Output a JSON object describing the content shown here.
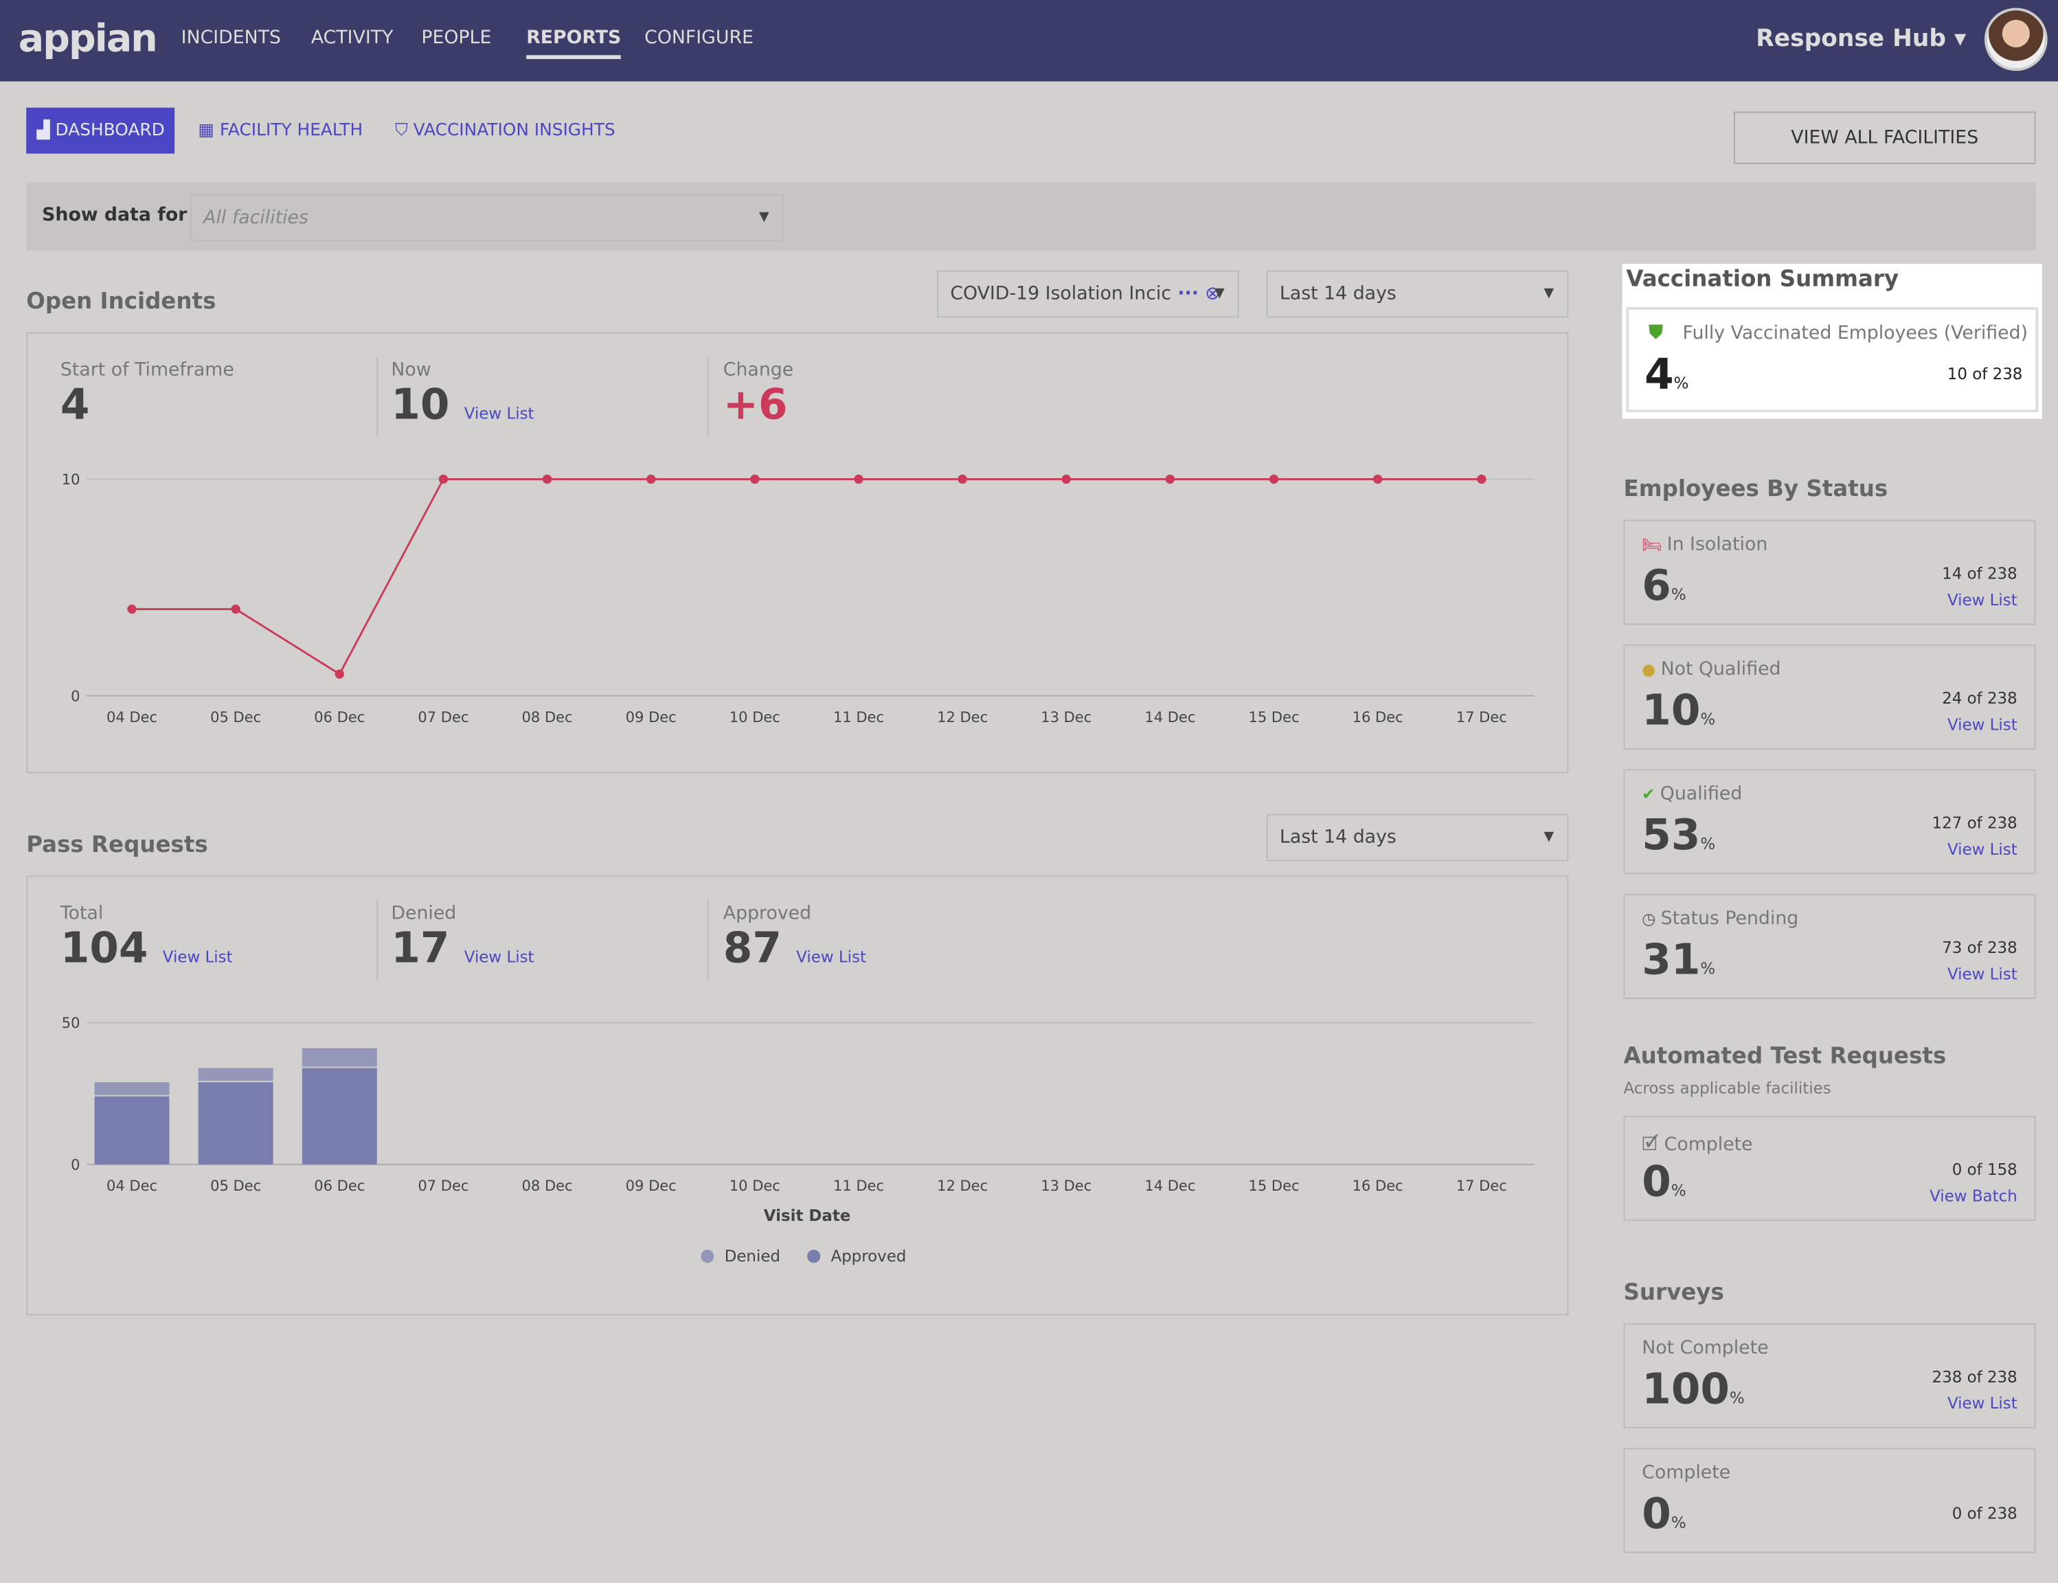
{
  "header": {
    "logo": "appian",
    "nav": [
      "INCIDENTS",
      "ACTIVITY",
      "PEOPLE",
      "REPORTS",
      "CONFIGURE"
    ],
    "active": "REPORTS",
    "site": "Response Hub ▾"
  },
  "subtabs": [
    {
      "label": "DASHBOARD",
      "icon": "bar-chart-icon"
    },
    {
      "label": "FACILITY HEALTH",
      "icon": "building-icon"
    },
    {
      "label": "VACCINATION INSIGHTS",
      "icon": "shield-icon"
    }
  ],
  "view_all": "VIEW ALL FACILITIES",
  "filter": {
    "label": "Show data for",
    "placeholder": "All facilities"
  },
  "open_incidents": {
    "title": "Open Incidents",
    "type_filter": "COVID-19 Isolation Incic",
    "range": "Last 14 days",
    "kpis": [
      {
        "label": "Start of Timeframe",
        "value": "4"
      },
      {
        "label": "Now",
        "value": "10",
        "link": "View List"
      },
      {
        "label": "Change",
        "value": "+6"
      }
    ]
  },
  "pass_requests": {
    "title": "Pass Requests",
    "range": "Last 14 days",
    "kpis": [
      {
        "label": "Total",
        "value": "104",
        "link": "View List"
      },
      {
        "label": "Denied",
        "value": "17",
        "link": "View List"
      },
      {
        "label": "Approved",
        "value": "87",
        "link": "View List"
      }
    ]
  },
  "chart_data": [
    {
      "type": "line",
      "categories": [
        "04 Dec",
        "05 Dec",
        "06 Dec",
        "07 Dec",
        "08 Dec",
        "09 Dec",
        "10 Dec",
        "11 Dec",
        "12 Dec",
        "13 Dec",
        "14 Dec",
        "15 Dec",
        "16 Dec",
        "17 Dec"
      ],
      "values": [
        4,
        4,
        1,
        10,
        10,
        10,
        10,
        10,
        10,
        10,
        10,
        10,
        10,
        10
      ],
      "ylim": [
        0,
        10
      ],
      "yticks": [
        "0",
        "10"
      ],
      "color": "#cc3a5a",
      "grid": true
    },
    {
      "type": "bar",
      "stacked": true,
      "categories": [
        "04 Dec",
        "05 Dec",
        "06 Dec",
        "07 Dec",
        "08 Dec",
        "09 Dec",
        "10 Dec",
        "11 Dec",
        "12 Dec",
        "13 Dec",
        "14 Dec",
        "15 Dec",
        "16 Dec",
        "17 Dec"
      ],
      "series": [
        {
          "name": "Approved",
          "values": [
            24,
            29,
            34,
            0,
            0,
            0,
            0,
            0,
            0,
            0,
            0,
            0,
            0,
            0
          ],
          "color": "#787dad"
        },
        {
          "name": "Denied",
          "values": [
            5,
            5,
            7,
            0,
            0,
            0,
            0,
            0,
            0,
            0,
            0,
            0,
            0,
            0
          ],
          "color": "#9597b8"
        }
      ],
      "ylim": [
        0,
        50
      ],
      "yticks": [
        "0",
        "50"
      ],
      "xlabel": "Visit Date",
      "legend": "bottom",
      "grid": true
    }
  ],
  "vaccination": {
    "title": "Vaccination Summary",
    "label": "Fully Vaccinated Employees (Verified)",
    "value": "4",
    "unit": "%",
    "count": "10 of 238"
  },
  "employees": {
    "title": "Employees By Status",
    "cards": [
      {
        "label": "In Isolation",
        "icon": "bed-icon",
        "value": "6",
        "unit": "%",
        "count": "14 of 238",
        "link": "View List"
      },
      {
        "label": "Not Qualified",
        "icon": "warning-icon",
        "value": "10",
        "unit": "%",
        "count": "24 of 238",
        "link": "View List"
      },
      {
        "label": "Qualified",
        "icon": "check-circle-icon",
        "value": "53",
        "unit": "%",
        "count": "127 of 238",
        "link": "View List"
      },
      {
        "label": "Status Pending",
        "icon": "clock-icon",
        "value": "31",
        "unit": "%",
        "count": "73 of 238",
        "link": "View List"
      }
    ]
  },
  "tests": {
    "title": "Automated Test Requests",
    "subtitle": "Across applicable facilities",
    "card": {
      "label": "Complete",
      "icon": "calendar-check-icon",
      "value": "0",
      "unit": "%",
      "count": "0 of 158",
      "link": "View Batch"
    }
  },
  "surveys": {
    "title": "Surveys",
    "cards": [
      {
        "label": "Not Complete",
        "value": "100",
        "unit": "%",
        "count": "238 of 238",
        "link": "View List"
      },
      {
        "label": "Complete",
        "value": "0",
        "unit": "%",
        "count": "0 of 238"
      }
    ]
  }
}
